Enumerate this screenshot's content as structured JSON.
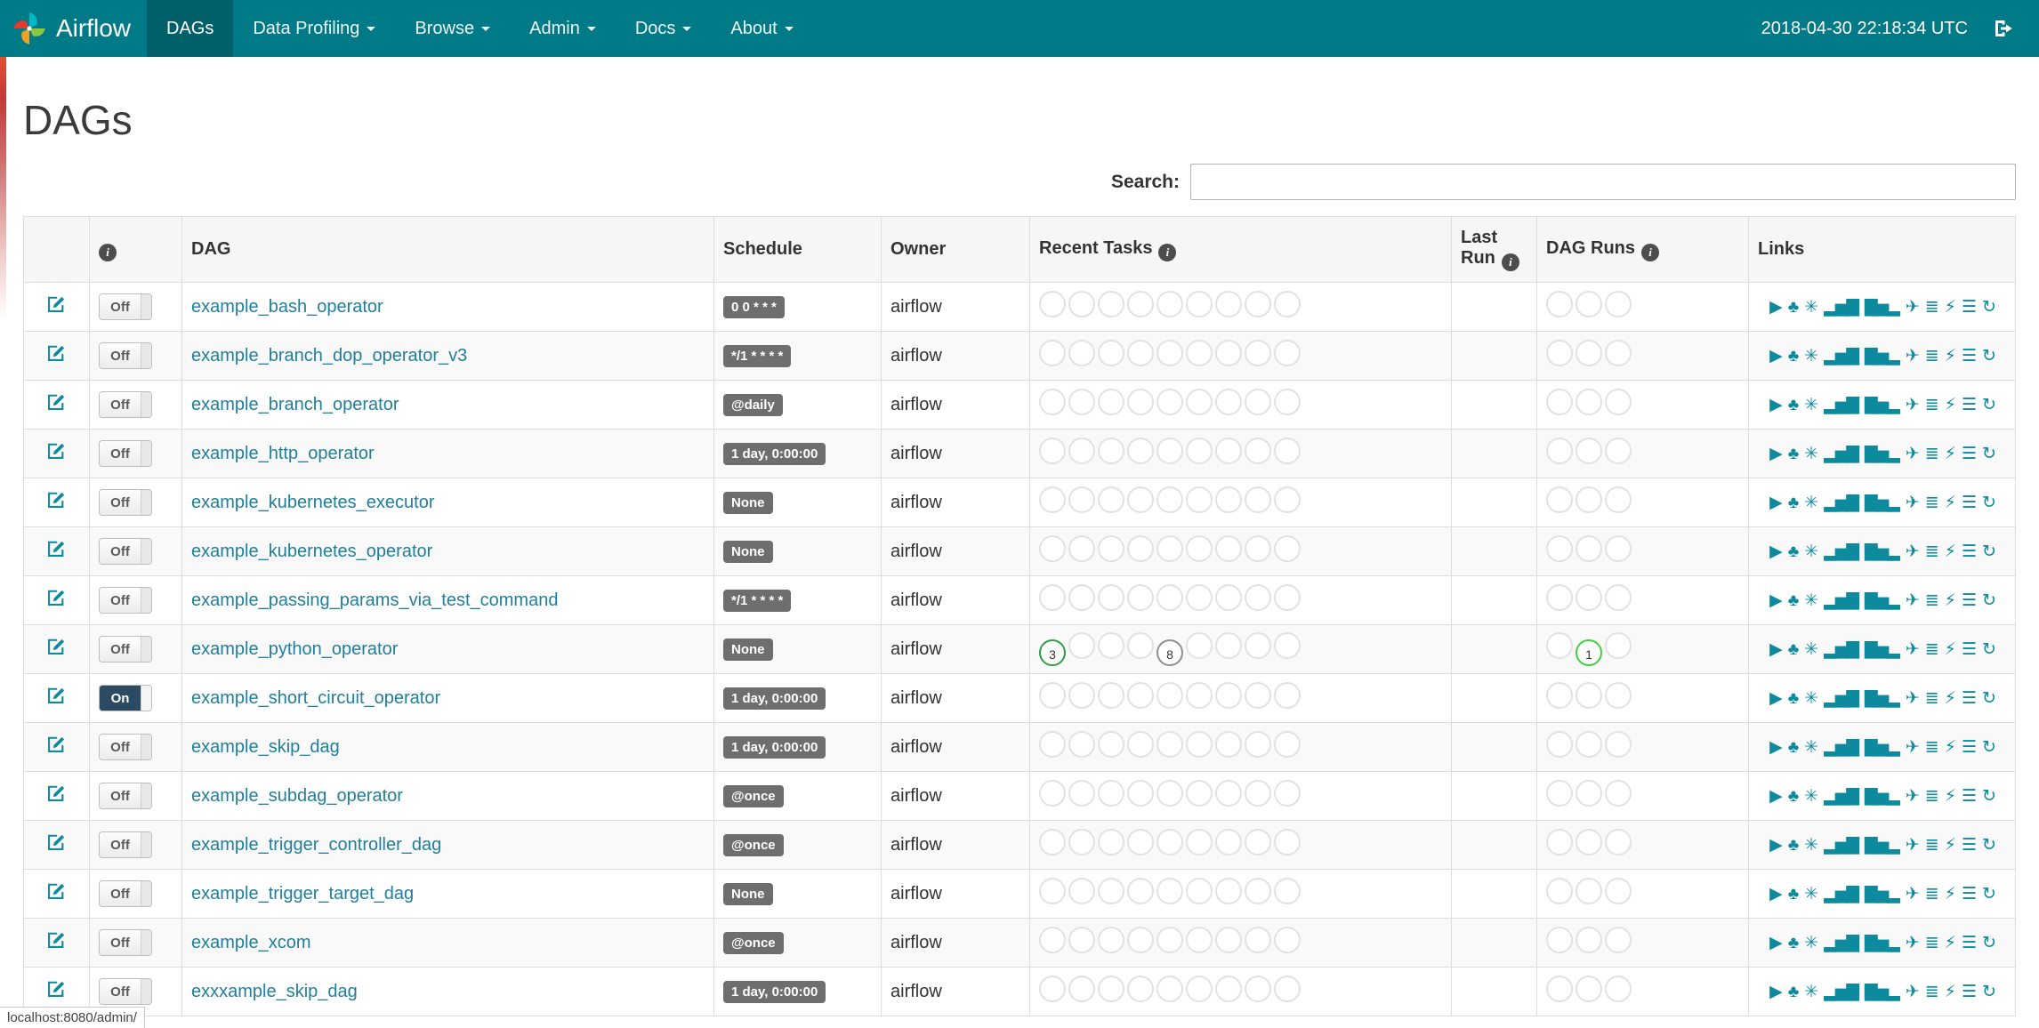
{
  "navbar": {
    "brand": "Airflow",
    "items": [
      {
        "label": "DAGs",
        "active": true,
        "caret": false
      },
      {
        "label": "Data Profiling",
        "active": false,
        "caret": true
      },
      {
        "label": "Browse",
        "active": false,
        "caret": true
      },
      {
        "label": "Admin",
        "active": false,
        "caret": true
      },
      {
        "label": "Docs",
        "active": false,
        "caret": true
      },
      {
        "label": "About",
        "active": false,
        "caret": true
      }
    ],
    "clock": "2018-04-30 22:18:34 UTC"
  },
  "page": {
    "title": "DAGs"
  },
  "search": {
    "label": "Search:",
    "value": ""
  },
  "table": {
    "headers": {
      "dag": "DAG",
      "schedule": "Schedule",
      "owner": "Owner",
      "recent_tasks": "Recent Tasks",
      "last_run": "Last Run",
      "dag_runs": "DAG Runs",
      "links": "Links"
    },
    "info_glyph": "i",
    "toggle_on_label": "On",
    "toggle_off_label": "Off",
    "recent_task_slots": 9,
    "dag_run_slots": 3,
    "link_icons": [
      {
        "name": "trigger-dag-icon",
        "glyph": "▶"
      },
      {
        "name": "tree-view-icon",
        "glyph": "♣"
      },
      {
        "name": "graph-view-icon",
        "glyph": "✳"
      },
      {
        "name": "task-duration-icon",
        "glyph": "▂▅▇"
      },
      {
        "name": "task-tries-icon",
        "glyph": "▇▅▂"
      },
      {
        "name": "landing-times-icon",
        "glyph": "✈"
      },
      {
        "name": "gantt-icon",
        "glyph": "≣"
      },
      {
        "name": "code-view-icon",
        "glyph": "⚡"
      },
      {
        "name": "logs-icon",
        "glyph": "☰"
      },
      {
        "name": "refresh-icon",
        "glyph": "↻"
      }
    ],
    "rows": [
      {
        "name": "example_bash_operator",
        "state": "off",
        "schedule": "0 0 * * *",
        "owner": "airflow",
        "recent_tasks": [],
        "dag_runs": []
      },
      {
        "name": "example_branch_dop_operator_v3",
        "state": "off",
        "schedule": "*/1 * * * *",
        "owner": "airflow",
        "recent_tasks": [],
        "dag_runs": []
      },
      {
        "name": "example_branch_operator",
        "state": "off",
        "schedule": "@daily",
        "owner": "airflow",
        "recent_tasks": [],
        "dag_runs": []
      },
      {
        "name": "example_http_operator",
        "state": "off",
        "schedule": "1 day, 0:00:00",
        "owner": "airflow",
        "recent_tasks": [],
        "dag_runs": []
      },
      {
        "name": "example_kubernetes_executor",
        "state": "off",
        "schedule": "None",
        "owner": "airflow",
        "recent_tasks": [],
        "dag_runs": []
      },
      {
        "name": "example_kubernetes_operator",
        "state": "off",
        "schedule": "None",
        "owner": "airflow",
        "recent_tasks": [],
        "dag_runs": []
      },
      {
        "name": "example_passing_params_via_test_command",
        "state": "off",
        "schedule": "*/1 * * * *",
        "owner": "airflow",
        "recent_tasks": [],
        "dag_runs": []
      },
      {
        "name": "example_python_operator",
        "state": "off",
        "schedule": "None",
        "owner": "airflow",
        "recent_tasks": [
          {
            "slot": 0,
            "value": 3,
            "color": "#2f9e44"
          },
          {
            "slot": 4,
            "value": 8,
            "color": "#8f8f8f"
          }
        ],
        "dag_runs": [
          {
            "slot": 1,
            "value": 1,
            "color": "#3fd13f"
          }
        ]
      },
      {
        "name": "example_short_circuit_operator",
        "state": "on",
        "schedule": "1 day, 0:00:00",
        "owner": "airflow",
        "recent_tasks": [],
        "dag_runs": []
      },
      {
        "name": "example_skip_dag",
        "state": "off",
        "schedule": "1 day, 0:00:00",
        "owner": "airflow",
        "recent_tasks": [],
        "dag_runs": []
      },
      {
        "name": "example_subdag_operator",
        "state": "off",
        "schedule": "@once",
        "owner": "airflow",
        "recent_tasks": [],
        "dag_runs": []
      },
      {
        "name": "example_trigger_controller_dag",
        "state": "off",
        "schedule": "@once",
        "owner": "airflow",
        "recent_tasks": [],
        "dag_runs": []
      },
      {
        "name": "example_trigger_target_dag",
        "state": "off",
        "schedule": "None",
        "owner": "airflow",
        "recent_tasks": [],
        "dag_runs": []
      },
      {
        "name": "example_xcom",
        "state": "off",
        "schedule": "@once",
        "owner": "airflow",
        "recent_tasks": [],
        "dag_runs": []
      },
      {
        "name": "exxxample_skip_dag",
        "state": "off",
        "schedule": "1 day, 0:00:00",
        "owner": "airflow",
        "recent_tasks": [],
        "dag_runs": []
      }
    ]
  },
  "status_bar": {
    "url": "localhost:8080/admin/"
  },
  "colors": {
    "navbar-bg": "#007a87",
    "navbar-active-bg": "#006069",
    "link": "#1f7f9c",
    "icon": "#0d8a9e",
    "badge-bg": "#6e6e6e",
    "toggle-on": "#2b4a63"
  }
}
